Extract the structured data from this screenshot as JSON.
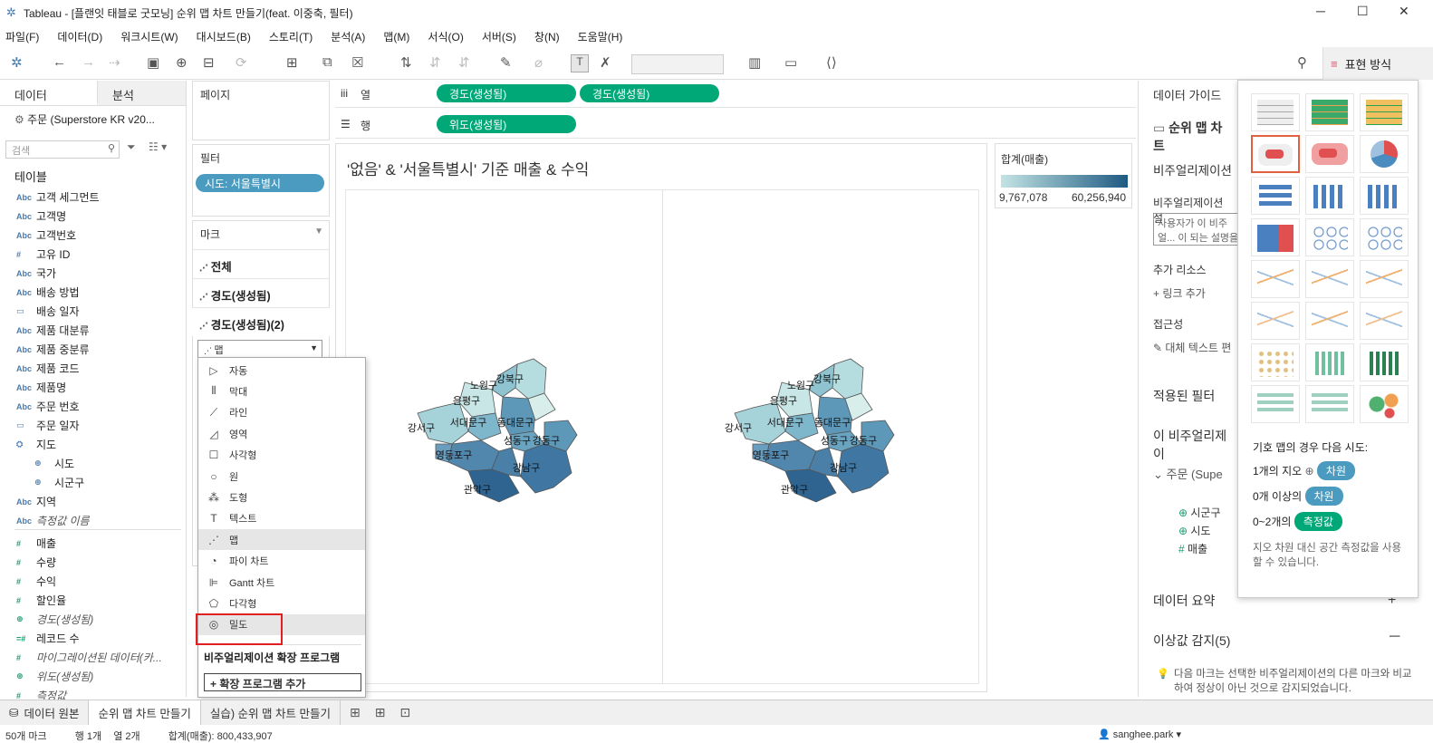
{
  "window": {
    "title": "Tableau - [플랜잇 태블로 굿모닝] 순위 맵 차트 만들기(feat. 이중축, 필터)"
  },
  "menu": [
    "파일(F)",
    "데이터(D)",
    "워크시트(W)",
    "대시보드(B)",
    "스토리(T)",
    "분석(A)",
    "맵(M)",
    "서식(O)",
    "서버(S)",
    "창(N)",
    "도움말(H)"
  ],
  "toolbar": {
    "show_me": "표현 방식"
  },
  "left": {
    "tab_data": "데이터",
    "tab_analysis": "분석",
    "datasource": "주문 (Superstore KR v20...",
    "search_placeholder": "검색",
    "tables_header": "테이블",
    "fields": [
      {
        "icon": "Abc",
        "label": "고객 세그먼트"
      },
      {
        "icon": "Abc",
        "label": "고객명"
      },
      {
        "icon": "Abc",
        "label": "고객번호"
      },
      {
        "icon": "#",
        "label": "고유 ID"
      },
      {
        "icon": "Abc",
        "label": "국가"
      },
      {
        "icon": "Abc",
        "label": "배송 방법"
      },
      {
        "icon": "▭",
        "label": "배송 일자"
      },
      {
        "icon": "Abc",
        "label": "제품 대분류"
      },
      {
        "icon": "Abc",
        "label": "제품 중분류"
      },
      {
        "icon": "Abc",
        "label": "제품 코드"
      },
      {
        "icon": "Abc",
        "label": "제품명"
      },
      {
        "icon": "Abc",
        "label": "주문 번호"
      },
      {
        "icon": "▭",
        "label": "주문 일자"
      },
      {
        "icon": "⛭",
        "label": "지도"
      },
      {
        "icon": "⊕",
        "label": "시도"
      },
      {
        "icon": "⊕",
        "label": "시군구"
      },
      {
        "icon": "Abc",
        "label": "지역"
      },
      {
        "icon": "Abc",
        "label": "측정값 이름"
      },
      {
        "icon": "#",
        "label": "매출"
      },
      {
        "icon": "#",
        "label": "수량"
      },
      {
        "icon": "#",
        "label": "수익"
      },
      {
        "icon": "#",
        "label": "할인율"
      },
      {
        "icon": "⊕",
        "label": "경도(생성됨)"
      },
      {
        "icon": "=#",
        "label": "레코드 수"
      },
      {
        "icon": "#",
        "label": "마이그레이션된 데이터(카..."
      },
      {
        "icon": "⊕",
        "label": "위도(생성됨)"
      },
      {
        "icon": "#",
        "label": "측정값"
      }
    ]
  },
  "shelves": {
    "pages": "페이지",
    "filters": "필터",
    "filter_pill": "시도: 서울특별시",
    "marks": "마크",
    "columns_label": "열",
    "rows_label": "행",
    "col_pill_1": "경도(생성됨)",
    "col_pill_2": "경도(생성됨)",
    "row_pill": "위도(생성됨)",
    "marks_all": "전체",
    "marks_1": "경도(생성됨)",
    "marks_2": "경도(생성됨)(2)",
    "mark_type": "맵"
  },
  "marktype_menu": {
    "items": [
      "자동",
      "막대",
      "라인",
      "영역",
      "사각형",
      "원",
      "도형",
      "텍스트",
      "맵",
      "파이 차트",
      "Gantt 차트",
      "다각형",
      "밀도"
    ],
    "ext_header": "비주얼리제이션 확장 프로그램",
    "ext_add": "확장 프로그램 추가"
  },
  "viz": {
    "title": "'없음' & '서울특별시' 기준 매출 & 수익",
    "districts": [
      "강북구",
      "노원구",
      "은평구",
      "서대문구",
      "동대문구",
      "강서구",
      "성동구",
      "강동구",
      "영등포구",
      "강남구",
      "관악구"
    ]
  },
  "legend": {
    "title": "합계(매출)",
    "min": "9,767,078",
    "max": "60,256,940"
  },
  "data_guide": {
    "title": "데이터 가이드",
    "chart": "순위 맵 차트",
    "viz_section": "비주얼리제이션",
    "viz_desc_label": "비주얼리제이션 설",
    "desc_text": "사용자가 이 비주얼... 이 되는 설명을 입...",
    "more_res": "추가 리소스",
    "link_add": "링크 추가",
    "access": "접근성",
    "alt_text": "대체 텍스트 편",
    "applied_filters": "적용된 필터",
    "this_viz": "이 비주얼리제이",
    "source": "주문 (Supe",
    "f1": "시군구",
    "f2": "시도",
    "f3": "매출",
    "data_summary": "데이터 요약",
    "anomaly": "이상값 감지(5)",
    "anomaly_desc": "다음 마크는 선택한 비주얼리제이션의 다른 마크와 비교하여 정상이 아닌 것으로 감지되었습니다."
  },
  "showme": {
    "hint_title": "기호 맵의 경우 다음 시도:",
    "row1_label": "1개의 지오",
    "row1_chip": "차원",
    "row2_label": "0개 이상의",
    "row2_chip": "차원",
    "row3_label": "0~2개의",
    "row3_chip": "측정값",
    "note": "지오 차원 대신 공간 측정값을 사용할 수 있습니다."
  },
  "tabs": {
    "datasource": "데이터 원본",
    "t1": "순위 맵 차트 만들기",
    "t2": "실습) 순위 맵 차트 만들기"
  },
  "status": {
    "marks": "50개 마크",
    "rows": "행 1개",
    "cols": "열 2개",
    "sum": "합계(매출): 800,433,907",
    "user": "sanghee.park"
  },
  "colors": {
    "accent_pill": "#00a877",
    "filter_pill": "#4a9bbf",
    "highlight_box": "#e02020"
  }
}
